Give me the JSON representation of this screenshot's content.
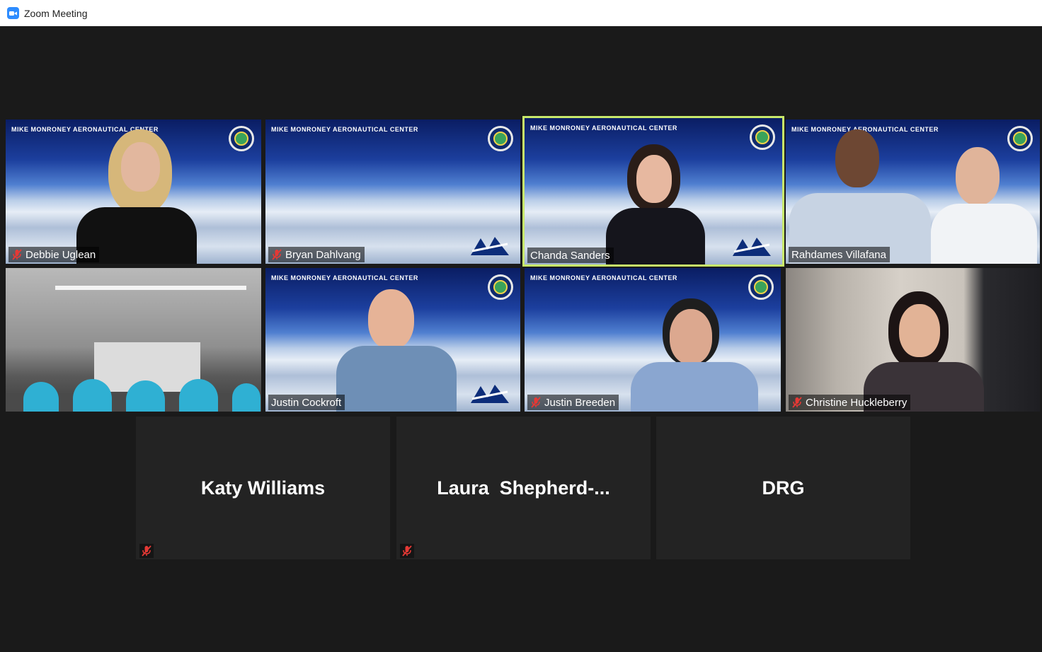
{
  "window": {
    "title": "Zoom Meeting",
    "app_icon": "zoom-camera-icon"
  },
  "banner_text": "MIKE MONRONEY AERONAUTICAL CENTER",
  "colors": {
    "active_speaker_border": "#c8e86a",
    "mute_icon": "#e53935",
    "background": "#1a1a1a"
  },
  "participants": [
    {
      "name": "Debbie Uglean",
      "muted": true
    },
    {
      "name": "Bryan Dahlvang",
      "muted": true
    },
    {
      "name": "Chanda Sanders",
      "muted": false,
      "active_speaker": true
    },
    {
      "name": "Rahdames Villafana",
      "muted": false
    },
    {
      "name": "",
      "muted": false
    },
    {
      "name": "Justin Cockroft",
      "muted": false
    },
    {
      "name": "Justin Breeden",
      "muted": true
    },
    {
      "name": "Christine Huckleberry",
      "muted": true
    },
    {
      "name": "Katy Williams",
      "muted": true,
      "video_off": true
    },
    {
      "name": "Laura  Shepherd-...",
      "muted": true,
      "video_off": true
    },
    {
      "name": "DRG",
      "muted": false,
      "video_off": true
    }
  ]
}
